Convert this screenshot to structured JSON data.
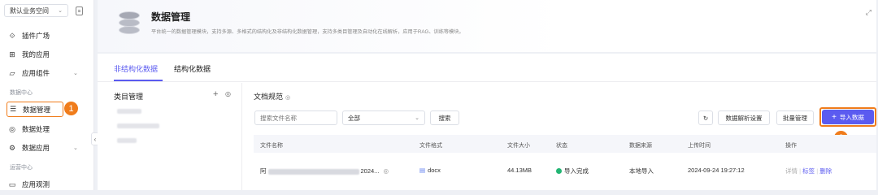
{
  "sidebar": {
    "workspace": "默认业务空间",
    "items": [
      {
        "label": "插件广场"
      },
      {
        "label": "我的应用"
      },
      {
        "label": "应用组件"
      },
      {
        "label": "数据管理"
      },
      {
        "label": "数据处理"
      },
      {
        "label": "数据应用"
      },
      {
        "label": "应用观测"
      }
    ],
    "groups": {
      "data_center": "数据中心",
      "ops_center": "运营中心"
    },
    "badge1": "1",
    "badge2": "2"
  },
  "header": {
    "title": "数据管理",
    "subtitle": "平台统一的数据管理模块，支持多源、多格式的结构化及非结构化数据管理，支持多类目管理及自动化在线解析，应用于RAG、训练等模块。"
  },
  "tabs": [
    {
      "label": "非结构化数据",
      "active": true
    },
    {
      "label": "结构化数据",
      "active": false
    }
  ],
  "category": {
    "title": "类目管理"
  },
  "docs": {
    "title": "文档规范",
    "search_placeholder": "搜索文件名称",
    "filter_value": "全部",
    "search_btn": "搜索",
    "parse_settings_btn": "数据解析设置",
    "batch_btn": "批量管理",
    "import_btn": "导入数据"
  },
  "table": {
    "headers": [
      "文件名称",
      "文件格式",
      "文件大小",
      "状态",
      "数据来源",
      "上传时间",
      "操作"
    ],
    "rows": [
      {
        "name_prefix": "阿",
        "name_suffix": "2024...",
        "format": "docx",
        "size": "44.13MB",
        "status": "导入完成",
        "source": "本地导入",
        "time": "2024-09-24 19:27:12",
        "actions": {
          "detail": "详情",
          "tag": "标签",
          "delete": "删除"
        }
      }
    ]
  },
  "colors": {
    "accent": "#5b5bf0",
    "highlight": "#f07c1b",
    "success": "#22b573"
  }
}
